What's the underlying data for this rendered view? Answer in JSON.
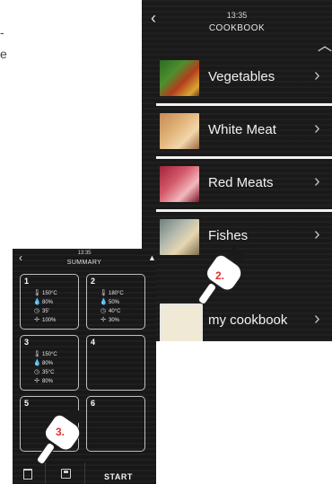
{
  "fragment_text": [
    "-",
    "e"
  ],
  "cookbook": {
    "time": "13:35",
    "title": "COOKBOOK",
    "categories": [
      {
        "label": "Vegetables"
      },
      {
        "label": "White Meat"
      },
      {
        "label": "Red Meats"
      },
      {
        "label": "Fishes"
      }
    ],
    "my_cookbook": "my cookbook"
  },
  "summary": {
    "time": "13:35",
    "title": "SUMMARY",
    "slots": [
      {
        "number": "1",
        "temp": "150°C",
        "humidity": "80%",
        "time": "35'",
        "fan": "100%"
      },
      {
        "number": "2",
        "temp": "180°C",
        "humidity": "50%",
        "time": "40°C",
        "fan": "30%"
      },
      {
        "number": "3",
        "temp": "150°C",
        "humidity": "80%",
        "time": "35°C",
        "fan": "80%"
      },
      {
        "number": "4"
      },
      {
        "number": "5"
      },
      {
        "number": "6"
      }
    ],
    "start_label": "START"
  },
  "steps": {
    "step2": "2.",
    "step3": "3."
  },
  "colors": {
    "screen_bg": "#1b1b1b",
    "text": "#f2f2f2",
    "step_number": "#e03030"
  },
  "icons": [
    "back-arrow-icon",
    "scroll-up-icon",
    "chevron-right-icon",
    "thermometer-icon",
    "humidity-drop-icon",
    "clock-icon",
    "fan-icon",
    "trash-icon",
    "save-icon",
    "hand-pointer-icon"
  ]
}
